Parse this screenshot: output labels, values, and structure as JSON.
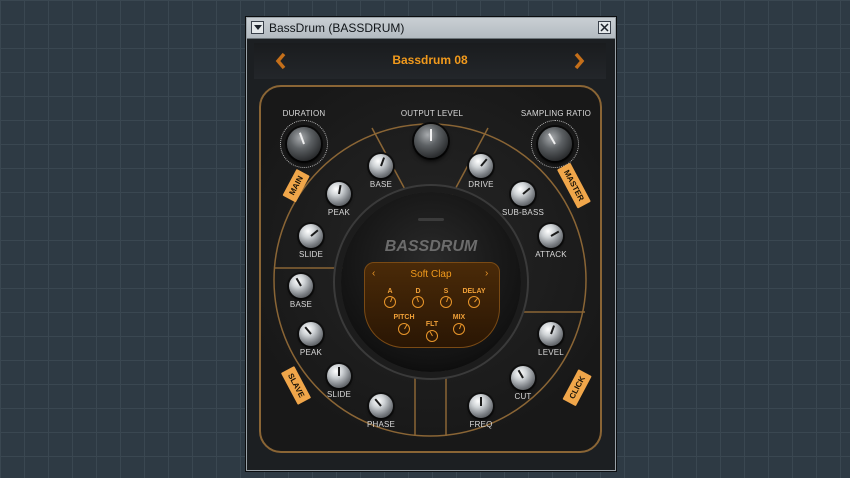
{
  "window": {
    "title": "BassDrum (BASSDRUM)",
    "preset": "Bassdrum 08"
  },
  "top": {
    "duration_label": "DURATION",
    "output_label": "OUTPUT LEVEL",
    "sampling_label": "SAMPLING RATIO"
  },
  "sections": {
    "main": "MAIN",
    "master": "MASTER",
    "slave": "SLAVE",
    "click": "CLICK"
  },
  "knobs": {
    "main_base": "BASE",
    "main_peak": "PEAK",
    "main_slide": "SLIDE",
    "master_drive": "DRIVE",
    "master_subbass": "SUB-BASS",
    "master_attack": "ATTACK",
    "slave_base": "BASE",
    "slave_peak": "PEAK",
    "slave_slide": "SLIDE",
    "slave_phase": "PHASE",
    "click_level": "LEVEL",
    "click_cut": "CUT",
    "click_freq": "FREQ"
  },
  "display": {
    "logo": "BASSDRUM",
    "sample": "Soft Clap",
    "prev": "‹",
    "next": "›",
    "a": "A",
    "d": "D",
    "s": "S",
    "delay": "DELAY",
    "pitch": "PITCH",
    "flt": "FLT",
    "mix": "MIX"
  },
  "colors": {
    "accent": "#f29a1c",
    "frame": "#8a6535",
    "tag": "#f0a64a"
  }
}
